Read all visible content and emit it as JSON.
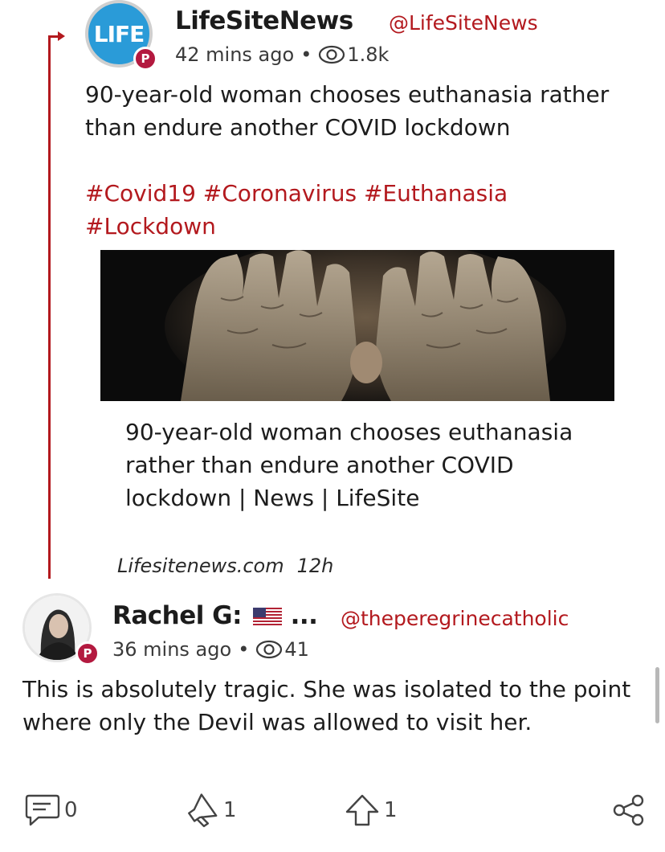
{
  "colors": {
    "accent": "#b3191e",
    "parler_badge": "#b3193f",
    "life_logo": "#2a9bd8"
  },
  "echoed_post": {
    "avatar_text": "LIFE",
    "badge": "P",
    "name": "LifeSiteNews",
    "handle": "@LifeSiteNews",
    "time": "42 mins ago",
    "views": "1.8k",
    "text": "90-year-old woman chooses euthanasia rather than endure another COVID lockdown",
    "hashtags": "#Covid19 #Coronavirus #Euthanasia #Lockdown",
    "link": {
      "title": "90-year-old woman chooses euthanasia rather than endure another COVID lockdown | News | LifeSite",
      "domain": "Lifesitenews.com",
      "age": "12h"
    }
  },
  "reply_post": {
    "badge": "P",
    "name": "Rachel G:",
    "name_suffix": "...",
    "handle": "@theperegrinecatholic",
    "time": "36 mins ago",
    "views": "41",
    "text": "This is absolutely tragic. She was isolated to the point where only the Devil was allowed to visit her."
  },
  "actions": {
    "comments": "0",
    "echoes": "1",
    "upvotes": "1"
  }
}
